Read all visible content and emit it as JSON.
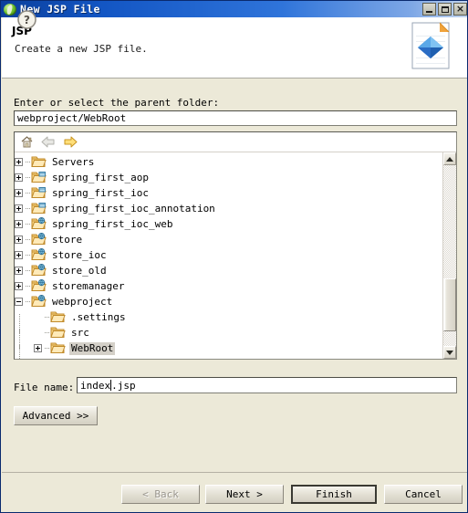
{
  "window": {
    "title": "New JSP File",
    "title_icon": "jsp-leaf-icon",
    "minimize_label": "",
    "maximize_label": "",
    "close_label": "×"
  },
  "header": {
    "title": "JSP",
    "description": "Create a new JSP file.",
    "banner_icon": "jsp-file-banner-icon"
  },
  "form": {
    "parent_folder_label": "Enter or select the parent folder:",
    "parent_folder_value": "webproject/WebRoot",
    "file_name_label": "File name:",
    "file_name_value": "index.jsp",
    "file_name_caret_after": "index",
    "advanced_label": "Advanced >>"
  },
  "tree_toolbar": {
    "home_icon": "home-icon",
    "back_icon": "back-arrow-icon",
    "forward_icon": "forward-arrow-icon"
  },
  "tree": {
    "nodes": [
      {
        "label": "Servers",
        "icon": "folder-icon",
        "expander": "plus",
        "depth": 0
      },
      {
        "label": "spring_first_aop",
        "icon": "project-icon",
        "expander": "plus",
        "depth": 0
      },
      {
        "label": "spring_first_ioc",
        "icon": "project-icon",
        "expander": "plus",
        "depth": 0
      },
      {
        "label": "spring_first_ioc_annotation",
        "icon": "project-icon",
        "expander": "plus",
        "depth": 0
      },
      {
        "label": "spring_first_ioc_web",
        "icon": "web-project-icon",
        "expander": "plus",
        "depth": 0
      },
      {
        "label": "store",
        "icon": "web-project-icon",
        "expander": "plus",
        "depth": 0
      },
      {
        "label": "store_ioc",
        "icon": "web-project-icon",
        "expander": "plus",
        "depth": 0
      },
      {
        "label": "store_old",
        "icon": "web-project-icon",
        "expander": "plus",
        "depth": 0
      },
      {
        "label": "storemanager",
        "icon": "web-project-icon",
        "expander": "plus",
        "depth": 0
      },
      {
        "label": "webproject",
        "icon": "web-project-icon",
        "expander": "minus",
        "depth": 0
      },
      {
        "label": ".settings",
        "icon": "folder-icon",
        "expander": "none",
        "depth": 1
      },
      {
        "label": "src",
        "icon": "folder-icon",
        "expander": "none",
        "depth": 1
      },
      {
        "label": "WebRoot",
        "icon": "folder-icon",
        "expander": "plus",
        "depth": 1,
        "selected": true
      }
    ],
    "scrollbar": {
      "up_arrow": "scroll-up-icon",
      "down_arrow": "scroll-down-icon"
    }
  },
  "footer": {
    "help_icon": "help-icon",
    "back_label": "< Back",
    "next_label": "Next >",
    "finish_label": "Finish",
    "cancel_label": "Cancel"
  },
  "colors": {
    "dialog_bg": "#ece9d8",
    "title_start": "#0b3f9c",
    "title_end": "#c4d6f0",
    "selection": "#d4d0c8",
    "field_bg": "#ffffff"
  }
}
